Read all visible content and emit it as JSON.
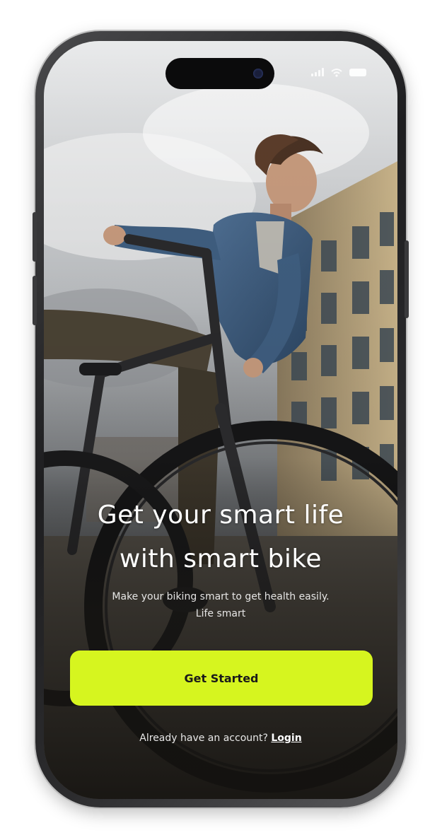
{
  "hero": {
    "headline_line1": "Get your smart life",
    "headline_line2": "with smart bike",
    "subtext_line1": "Make your biking smart to get health easily.",
    "subtext_line2": "Life smart"
  },
  "actions": {
    "primary_label": "Get Started",
    "account_prompt": "Already have an account?",
    "login_label": "Login"
  },
  "status_bar": {
    "icons": [
      "signal-icon",
      "wifi-icon",
      "battery-icon"
    ]
  },
  "colors": {
    "accent": "#d6f51f",
    "primary_text": "#ffffff",
    "button_text": "#1a1a1a",
    "frame": "#1e1e20"
  }
}
